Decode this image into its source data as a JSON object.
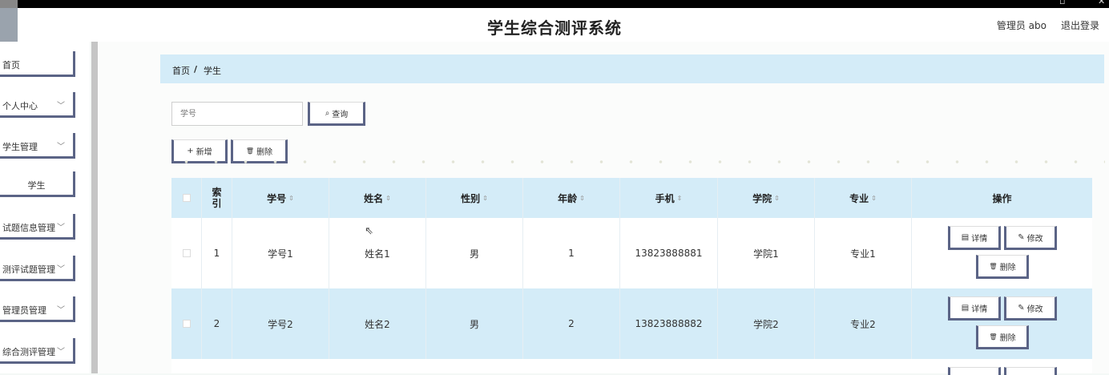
{
  "app": {
    "title": "学生综合测评系统",
    "admin_label": "管理员 abo",
    "logout_label": "退出登录"
  },
  "window": {
    "restore_glyph": "▫",
    "close_glyph": "✕"
  },
  "sidebar": {
    "items": [
      {
        "label": "首页",
        "has_chevron": false
      },
      {
        "label": "个人中心",
        "has_chevron": true
      },
      {
        "label": "学生管理",
        "has_chevron": true
      },
      {
        "label": "学生",
        "has_chevron": false
      },
      {
        "label": "试题信息管理",
        "has_chevron": true
      },
      {
        "label": "测评试题管理",
        "has_chevron": true
      },
      {
        "label": "管理员管理",
        "has_chevron": true
      },
      {
        "label": "综合测评管理",
        "has_chevron": true
      }
    ],
    "chevron": "﹀"
  },
  "breadcrumb": {
    "home": "首页",
    "sep": "/",
    "current": "学生"
  },
  "search": {
    "placeholder": "学号",
    "button_label": "查询",
    "button_icon": "⌕"
  },
  "actions": {
    "add_label": "新增",
    "add_icon": "+",
    "delete_label": "删除",
    "delete_icon": "🗑"
  },
  "table": {
    "headers": {
      "index_top": "索",
      "index_bottom": "引",
      "student_no": "学号",
      "name": "姓名",
      "gender": "性别",
      "age": "年龄",
      "phone": "手机",
      "college": "学院",
      "major": "专业",
      "ops": "操作",
      "sort_glyph": "⇕"
    },
    "rows": [
      {
        "index": "1",
        "student_no": "学号1",
        "name": "姓名1",
        "gender": "男",
        "age": "1",
        "phone": "13823888881",
        "college": "学院1",
        "major": "专业1"
      },
      {
        "index": "2",
        "student_no": "学号2",
        "name": "姓名2",
        "gender": "男",
        "age": "2",
        "phone": "13823888882",
        "college": "学院2",
        "major": "专业2"
      }
    ],
    "row_buttons": {
      "detail_label": "详情",
      "detail_icon": "▤",
      "edit_label": "修改",
      "edit_icon": "✎",
      "delete_label": "删除",
      "delete_icon": "🗑"
    }
  },
  "colors": {
    "accent": "#5b6486",
    "header_bg": "#d4ecf8",
    "alt_row": "#d4ecf8"
  }
}
